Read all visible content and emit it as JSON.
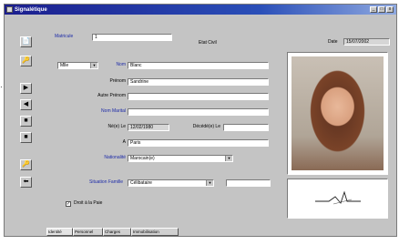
{
  "window": {
    "title": "Signalétique",
    "min_label": "_",
    "max_label": "□",
    "close_label": "x"
  },
  "toolbar": {
    "new_icon": "📄",
    "key_icon": "🔑",
    "next_icon": "▶",
    "prev_icon": "◀",
    "first_icon": "■",
    "last_icon": "■",
    "import_icon": "🔑",
    "export_icon": "⬅"
  },
  "header": {
    "matricule_label": "Matricule",
    "matricule_value": "1",
    "etat_civil_label": "Etat Civil",
    "date_label": "Date",
    "date_value": "15/07/2002"
  },
  "identity": {
    "civilite_value": "Mlle",
    "nom_label": "Nom",
    "nom_value": "Blanc",
    "prenom_label": "Prénom",
    "prenom_value": "Sandrine",
    "autre_prenom_label": "Autre Prénom",
    "autre_prenom_value": "",
    "nom_marital_label": "Nom Marital",
    "nom_marital_value": "",
    "ne_le_label": "Né(e) Le",
    "ne_le_value": "12/02/1980",
    "dep_label": "Décédé(e) Le",
    "dep_value": "",
    "a_label": "A",
    "a_value": "Paris",
    "nationalite_label": "Nationalité",
    "nationalite_value": "Marocain(e)"
  },
  "family": {
    "situation_label": "Situation Famille",
    "situation_value": "Célibataire",
    "extra_value": "",
    "droit_label": "Droit à la Paie",
    "droit_checked": true
  },
  "tabs": [
    {
      "label": "Identité",
      "active": true
    },
    {
      "label": "Personnel",
      "active": false
    },
    {
      "label": "Charges",
      "active": false
    },
    {
      "label": "Immobilisation",
      "active": false
    }
  ],
  "signature": {
    "alt": "signature"
  }
}
